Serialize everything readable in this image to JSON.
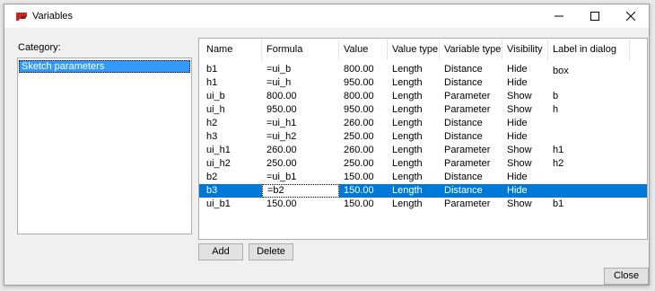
{
  "window": {
    "title": "Variables",
    "app_icon": "varlock-app-icon",
    "controls": [
      "minimize-icon",
      "maximize-icon",
      "close-icon"
    ]
  },
  "category": {
    "label": "Category:",
    "items": [
      "Sketch parameters"
    ],
    "selected": "Sketch parameters"
  },
  "table": {
    "columns": [
      "Name",
      "Formula",
      "Value",
      "Value type",
      "Variable type",
      "Visibility",
      "Label in dialog box"
    ],
    "rows": [
      [
        "b1",
        "=ui_b",
        "800.00",
        "Length",
        "Distance",
        "Hide",
        ""
      ],
      [
        "h1",
        "=ui_h",
        "950.00",
        "Length",
        "Distance",
        "Hide",
        ""
      ],
      [
        "ui_b",
        "800.00",
        "800.00",
        "Length",
        "Parameter",
        "Show",
        "b"
      ],
      [
        "ui_h",
        "950.00",
        "950.00",
        "Length",
        "Parameter",
        "Show",
        "h"
      ],
      [
        "h2",
        "=ui_h1",
        "260.00",
        "Length",
        "Distance",
        "Hide",
        ""
      ],
      [
        "h3",
        "=ui_h2",
        "250.00",
        "Length",
        "Distance",
        "Hide",
        ""
      ],
      [
        "ui_h1",
        "260.00",
        "260.00",
        "Length",
        "Parameter",
        "Show",
        "h1"
      ],
      [
        "ui_h2",
        "250.00",
        "250.00",
        "Length",
        "Parameter",
        "Show",
        "h2"
      ],
      [
        "b2",
        "=ui_b1",
        "150.00",
        "Length",
        "Distance",
        "Hide",
        ""
      ],
      [
        "b3",
        "=b2",
        "150.00",
        "Length",
        "Distance",
        "Hide",
        ""
      ],
      [
        "ui_b1",
        "150.00",
        "150.00",
        "Length",
        "Parameter",
        "Show",
        "b1"
      ]
    ],
    "selected_row": 9,
    "editing_cell": "Formula"
  },
  "buttons": {
    "add": "Add",
    "delete": "Delete",
    "close": "Close"
  },
  "colors": {
    "selection": "#0078d7",
    "category_selection": "#3399ff",
    "app_icon": "#c62828"
  }
}
